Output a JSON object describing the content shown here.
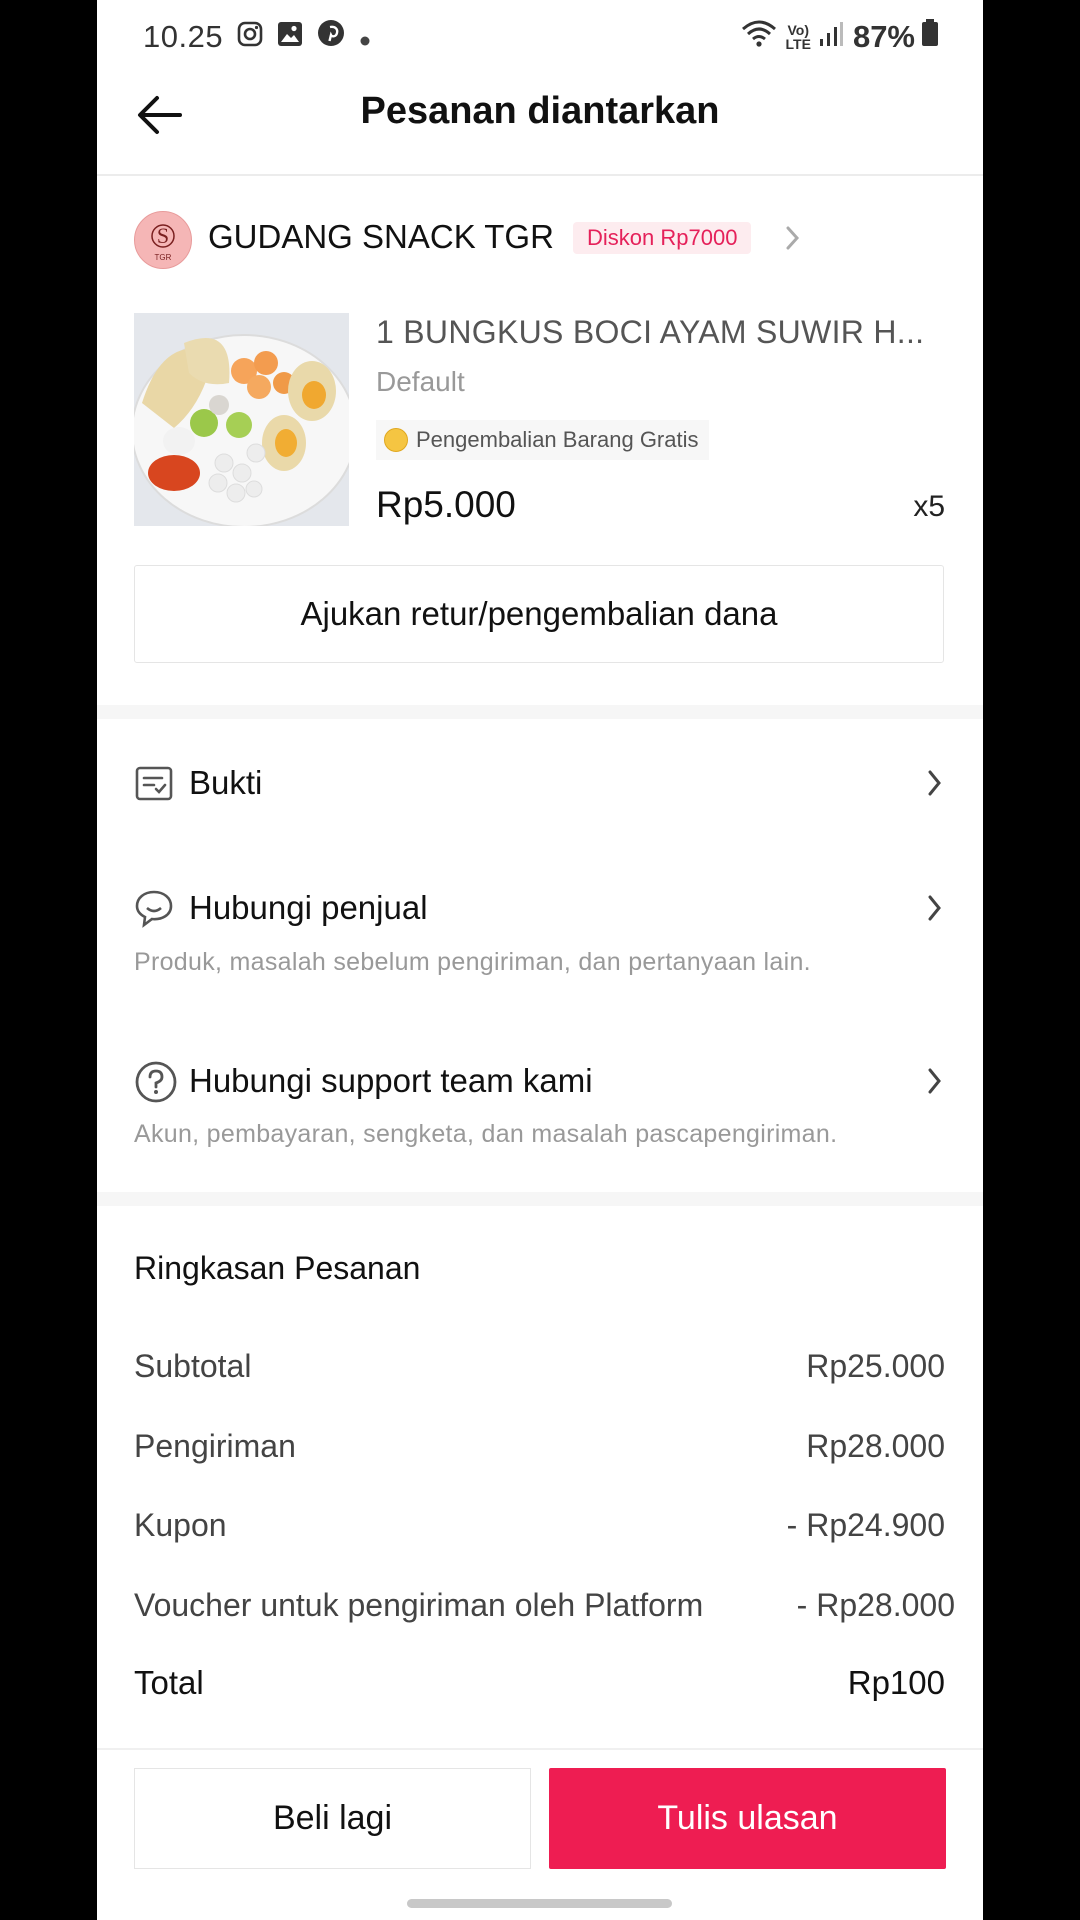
{
  "status_bar": {
    "time": "10.25",
    "battery": "87%",
    "network": "LTE"
  },
  "header": {
    "title": "Pesanan diantarkan"
  },
  "shop": {
    "name": "GUDANG SNACK TGR",
    "discount_badge": "Diskon Rp7000",
    "logo_text": "TGR"
  },
  "product": {
    "name": "1 BUNGKUS BOCI AYAM SUWIR H...",
    "variant": "Default",
    "return_badge": "Pengembalian Barang Gratis",
    "price": "Rp5.000",
    "quantity": "x5"
  },
  "actions": {
    "refund_label": "Ajukan retur/pengembalian dana"
  },
  "menu": [
    {
      "label": "Bukti",
      "sub": ""
    },
    {
      "label": "Hubungi penjual",
      "sub": "Produk, masalah sebelum pengiriman, dan pertanyaan lain."
    },
    {
      "label": "Hubungi support team kami",
      "sub": "Akun, pembayaran, sengketa, dan masalah pascapengiriman."
    }
  ],
  "summary": {
    "title": "Ringkasan Pesanan",
    "rows": [
      {
        "label": "Subtotal",
        "value": "Rp25.000"
      },
      {
        "label": "Pengiriman",
        "value": "Rp28.000"
      },
      {
        "label": "Kupon",
        "value": "- Rp24.900"
      },
      {
        "label": "Voucher untuk pengiriman oleh Platform",
        "value": "- Rp28.000"
      }
    ],
    "total_label": "Total",
    "total_value": "Rp100"
  },
  "bottom": {
    "buy_again_label": "Beli lagi",
    "review_label": "Tulis ulasan"
  },
  "colors": {
    "accent": "#ee1d52",
    "badge_bg": "#fdecef"
  }
}
